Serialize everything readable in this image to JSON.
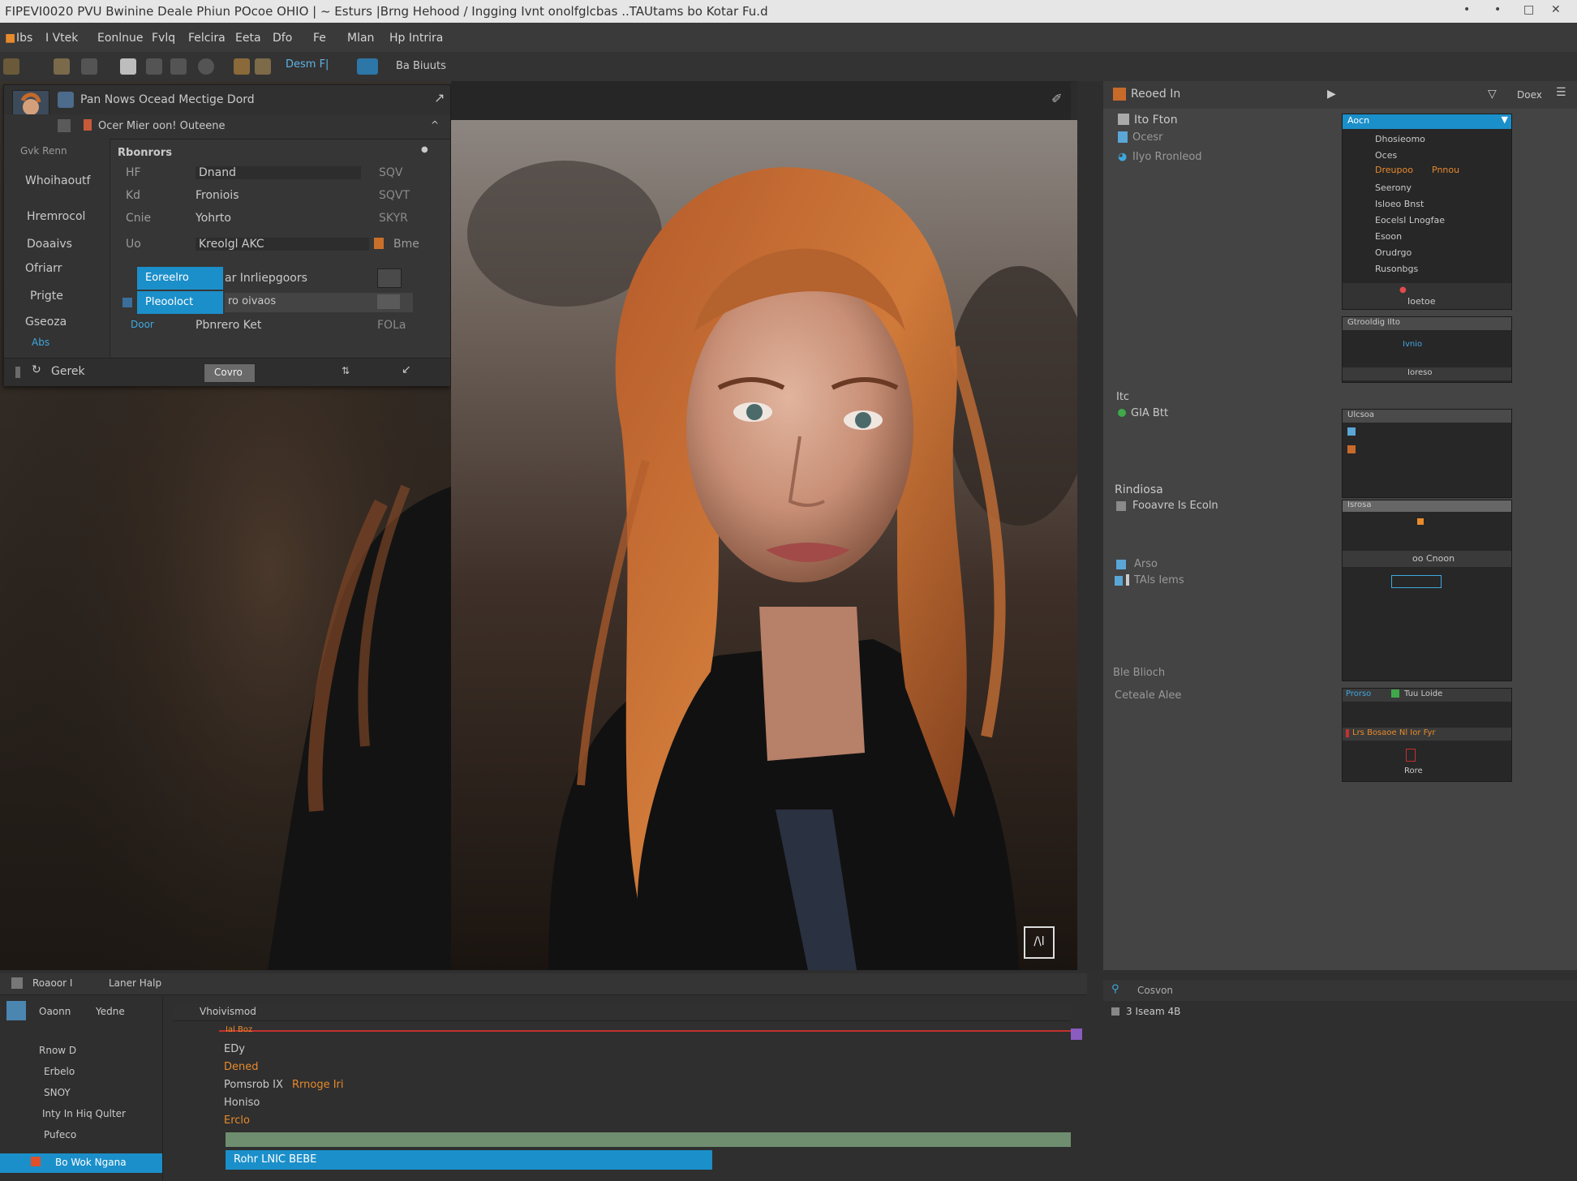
{
  "window": {
    "title": "FIPEVI0020 PVU Bwinine Deale Phiun POcoe OHIO | ~ Esturs |Brng Hehood / Ingging Ivnt onolfglcbas ..TAUtams bo Kotar Fu.d",
    "controls": [
      "•",
      "•",
      "□",
      "✕"
    ]
  },
  "menu": [
    "Ibs",
    "I Vtek",
    "Eonlnue",
    "Fvlq",
    "Felcira",
    "Eeta",
    "Dfo",
    "Fe",
    "Mlan",
    "Hp Intrira"
  ],
  "toolbar": {
    "mode_label": "Desm F|",
    "extra_label": "Ba Biuuts"
  },
  "canvas": {
    "corner_mark": "/\\l"
  },
  "left_panel": {
    "header_title": "Pan Nows Ocead Mectige Dord",
    "subheader": "Ocer Mier oon! Outeene",
    "col_sidebar_title": "Gvk Renn",
    "col_main_title": "Rbonrors",
    "sidebar_items": [
      "Whoihaoutf",
      "Hremrocol",
      "Doaaivs",
      "Ofriarr",
      "Prigte",
      "Gseoza",
      "Abs"
    ],
    "rows": [
      {
        "k": "HF",
        "name": "Dnand",
        "val": "SQV"
      },
      {
        "k": "Kd",
        "name": "Froniois",
        "val": "SQVT"
      },
      {
        "k": "Cnie",
        "name": "Yohrto",
        "val": "SKYR"
      },
      {
        "k": "Uo",
        "name": "Kreolgl AKC",
        "val": "Bme"
      }
    ],
    "selected_items": [
      "Eoreelro",
      "Pleooloct"
    ],
    "selected_details": [
      "ar Inrliepgoors",
      "ro oivaos"
    ],
    "extra_row": {
      "tag": "Door",
      "name": "Pbnrero Ket",
      "val": "FOLa"
    },
    "footer_label": "Gerek",
    "footer_button": "Covro"
  },
  "right_panel": {
    "header_title": "Reoed In",
    "header_right": "Doex",
    "tree": [
      {
        "label": "Ito Fton"
      },
      {
        "label": "Ocesr"
      },
      {
        "label": "IIyo Rronleod"
      },
      {
        "label": "Itc"
      },
      {
        "label": "GIA Btt"
      },
      {
        "label": "Rindiosa"
      },
      {
        "label": "Fooavre Is Ecoln"
      },
      {
        "label": "Arso"
      },
      {
        "label": "TAls Iems"
      },
      {
        "label": "Ble Blioch"
      },
      {
        "label": "Ceteale Alee"
      }
    ],
    "dropdown": {
      "selected": "Aocn",
      "items": [
        "Dhosieomo",
        "Oces",
        "Dreupoo",
        "Seerony",
        "Isloeo Bnst",
        "Eocelsl Lnogfae",
        "Esoon",
        "Orudrgo",
        "Rusonbgs"
      ],
      "item_accent": "Pnnou",
      "footer": "Ioetoe"
    },
    "sub1": {
      "title": "Gtrooldig Ilto",
      "badge": "Ivnio",
      "footer": "Ioreso"
    },
    "sub2": {
      "title": "Ulcsoa"
    },
    "sub3": {
      "title": "Isrosa",
      "mid": "oo Cnoon"
    },
    "sub4": {
      "title": "Prorso",
      "mid": "Tuu Loide",
      "row": "Lrs Bosaoe Nl Ior Fyr",
      "footer": "Rore"
    }
  },
  "bottom_left": {
    "toolbar_title": "Roaoor I",
    "toolbar_sub": "Laner Halp",
    "tabs": [
      "Oaonn",
      "Yedne"
    ],
    "layers": [
      "Rnow D",
      "Erbelo",
      "SNOY",
      "Inty In Hiq Qulter",
      "Pufeco",
      "Bo Wok Ngana"
    ]
  },
  "timeline": {
    "title": "Vhoivismod",
    "items": [
      "EDy",
      "Dened",
      "Pomsrob IX",
      "Honiso",
      "Erclo"
    ],
    "accent_item": "Rrnoge Iri",
    "top_marker": "Ial Boz",
    "clip_label": "Rohr LNIC BEBE"
  },
  "bottom_right": {
    "search_label": "Cosvon",
    "info": "3 Iseam 4B"
  },
  "colors": {
    "accent_blue": "#1b8fca",
    "accent_orange": "#e78a2c",
    "timeline_red": "#c43030",
    "timeline_green": "#6f8d6f"
  }
}
